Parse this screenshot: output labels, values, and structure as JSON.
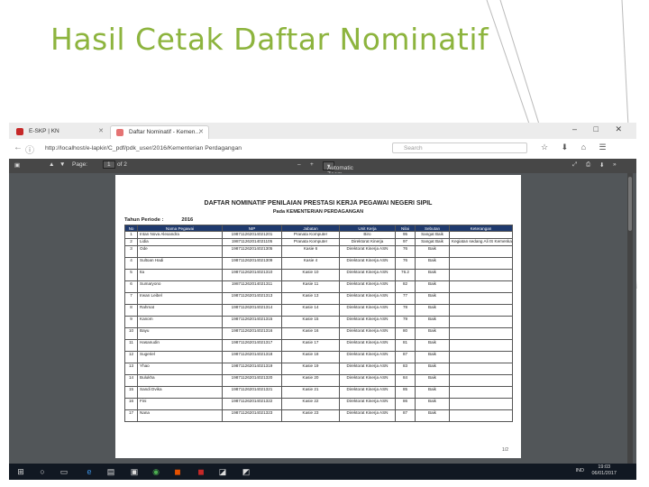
{
  "slide": {
    "title": "Hasil Cetak Daftar Nominatif"
  },
  "browser": {
    "tabs": [
      {
        "label": "E-SKP | KN",
        "icon": "red-badge-icon",
        "color": "#c62828"
      },
      {
        "label": "Daftar Nominatif - Kemen…",
        "icon": "pdf-icon",
        "color": "#e57373"
      }
    ],
    "url": "http://localhost/e-lapkir/C_pdf/pdk_user/2016/Kementerian Perdagangan",
    "search_placeholder": "Search"
  },
  "pdf_toolbar": {
    "page_label": "Page:",
    "page_value": "1",
    "page_total": "of 2",
    "zoom": "Automatic Zoom"
  },
  "document": {
    "title": "DAFTAR NOMINATIF PENILAIAN PRESTASI KERJA PEGAWAI NEGERI SIPIL",
    "subtitle": "Pada KEMENTERIAN PERDAGANGAN",
    "period_label": "Tahun Periode :",
    "period_value": "2016",
    "columns": [
      "No",
      "Nama Pegawai",
      "NIP",
      "Jabatan",
      "Unit Kerja",
      "Nilai",
      "Sebutan",
      "Keterangan"
    ],
    "rows": [
      [
        "1",
        "Intan Nova Alexandra",
        "198711262014021201",
        "Pranata Komputer",
        "Biro",
        "95",
        "Sangat Baik",
        ""
      ],
      [
        "2",
        "Lidia",
        "198711262014021105",
        "Pranata Komputer",
        "Direktorat Kinerja",
        "97",
        "Sangat Baik",
        "Kegiatan sedang Ali IS Kemenkau"
      ],
      [
        "3",
        "Ode",
        "198711262014021305",
        "Kasie 6",
        "Direktorat Kinerja ASN",
        "76",
        "Baik",
        ""
      ],
      [
        "4",
        "Sultoan Hadi",
        "198711262014021309",
        "Kasie 4",
        "Direktorat Kinerja ASN",
        "76",
        "Baik",
        ""
      ],
      [
        "5",
        "Ita",
        "198711262014021310",
        "Kasie 10",
        "Direktorat Kinerja ASN",
        "76.2",
        "Baik",
        ""
      ],
      [
        "6",
        "Sumaryono",
        "198711262014021311",
        "Kasie 11",
        "Direktorat Kinerja ASN",
        "82",
        "Baik",
        ""
      ],
      [
        "7",
        "Irwan Leibel",
        "198711262014021313",
        "Kasie 13",
        "Direktorat Kinerja ASN",
        "77",
        "Baik",
        ""
      ],
      [
        "8",
        "Rahmat",
        "198711262014021314",
        "Kasie 14",
        "Direktorat Kinerja ASN",
        "78",
        "Baik",
        ""
      ],
      [
        "9",
        "Kanom",
        "198711262014021315",
        "Kasie 15",
        "Direktorat Kinerja ASN",
        "79",
        "Baik",
        ""
      ],
      [
        "10",
        "Bayu",
        "198711262014021316",
        "Kasie 16",
        "Direktorat Kinerja ASN",
        "80",
        "Baik",
        ""
      ],
      [
        "11",
        "Hasanudin",
        "198711262014021317",
        "Kasie 17",
        "Direktorat Kinerja ASN",
        "81",
        "Baik",
        ""
      ],
      [
        "12",
        "Sugeriel",
        "198711262014021318",
        "Kasie 18",
        "Direktorat Kinerja ASN",
        "87",
        "Baik",
        ""
      ],
      [
        "13",
        "Yhao",
        "198711262014021319",
        "Kasie 19",
        "Direktorat Kinerja ASN",
        "83",
        "Baik",
        ""
      ],
      [
        "14",
        "Bulukha",
        "198711262014021320",
        "Kasie 20",
        "Direktorat Kinerja ASN",
        "84",
        "Baik",
        ""
      ],
      [
        "15",
        "Sandi Dvika",
        "198711262014021321",
        "Kasie 21",
        "Direktorat Kinerja ASN",
        "85",
        "Baik",
        ""
      ],
      [
        "16",
        "Fini",
        "198711262014021322",
        "Kasie 22",
        "Direktorat Kinerja ASN",
        "86",
        "Baik",
        ""
      ],
      [
        "17",
        "Nana",
        "198711262014021323",
        "Kasie 23",
        "Direktorat Kinerja ASN",
        "87",
        "Baik",
        ""
      ]
    ],
    "page_number": "1/2"
  },
  "taskbar": {
    "language": "IND",
    "time": "19:03",
    "date": "06/01/2017"
  }
}
